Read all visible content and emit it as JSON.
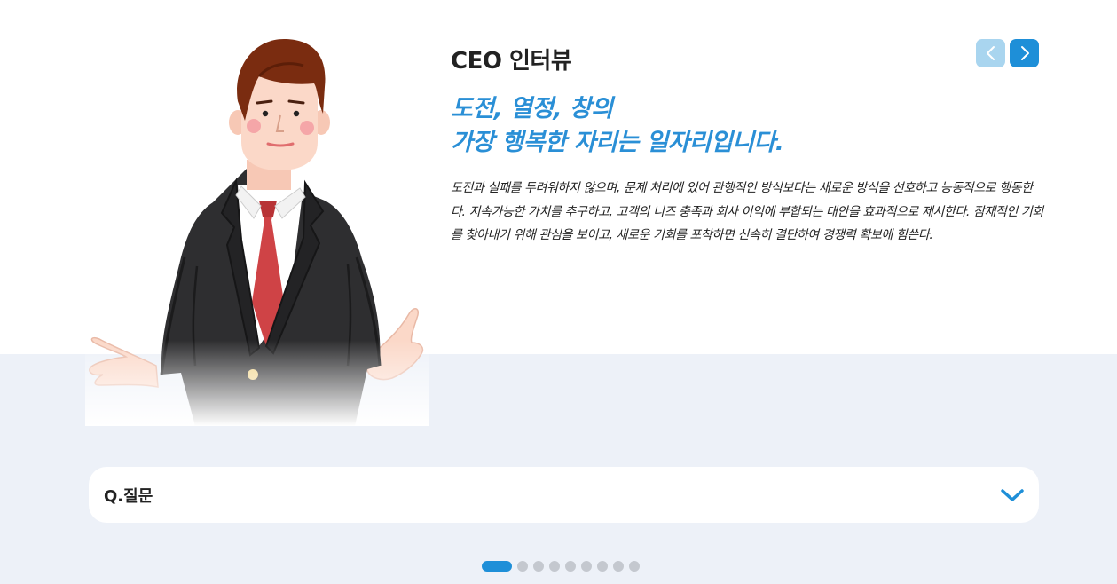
{
  "interview": {
    "title": "CEO 인터뷰",
    "headline_line1": "도전, 열정, 창의",
    "headline_line2": "가장 행복한 자리는 일자리입니다.",
    "body": "도전과 실패를 두려워하지 않으며, 문제 처리에 있어 관행적인 방식보다는 새로운 방식을 선호하고 능동적으로 행동한다. 지속가능한 가치를 추구하고, 고객의 니즈 충족과 회사 이익에 부합되는 대안을 효과적으로 제시한다. 잠재적인 기회를 찾아내기 위해 관심을 보이고, 새로운 기회를 포착하면 신속히 결단하여 경쟁력 확보에 힘쓴다."
  },
  "nav": {
    "prev_icon": "chevron-left-icon",
    "next_icon": "chevron-right-icon"
  },
  "faq": {
    "label": "Q.질문",
    "icon": "chevron-down-icon"
  },
  "pagination": {
    "total": 9,
    "active": 1
  },
  "colors": {
    "accent": "#1e8fd8",
    "accent_light": "#a9d5ef",
    "headline": "#2a8fd6",
    "band": "#edf1f8",
    "dot": "#c4c8cf"
  }
}
